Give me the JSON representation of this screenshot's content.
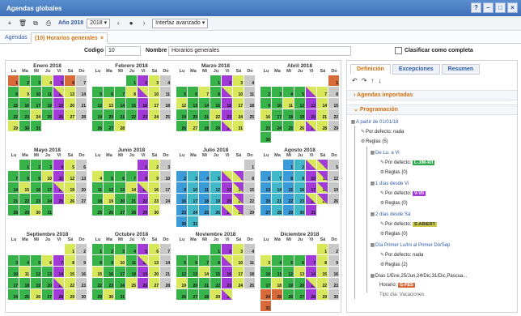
{
  "window": {
    "title": "Agendas globales"
  },
  "toolbar": {
    "year_label": "Año 2018",
    "year_value": "2018 ▾",
    "prev_icon": "‹",
    "now_icon": "●",
    "next_icon": "›",
    "filter_value": "Interfaz avanzado ▾"
  },
  "tabs": {
    "agendas": "Agendas",
    "active": "(10) Horarios generales",
    "close": "×"
  },
  "fields": {
    "codigo_label": "Codigo",
    "codigo_value": "10",
    "nombre_label": "Nombre",
    "nombre_value": "Horarios generales",
    "clasificar_label": "Clasificar como completa"
  },
  "weekday_headers": [
    "Lu",
    "Ma",
    "Mi",
    "Ju",
    "Vi",
    "Sá",
    "Do"
  ],
  "months": [
    {
      "title": "Enero 2018"
    },
    {
      "title": "Febrero 2018"
    },
    {
      "title": "Marzo 2018"
    },
    {
      "title": "Abril 2018"
    },
    {
      "title": "Mayo 2018"
    },
    {
      "title": "Junio 2018"
    },
    {
      "title": "Julio 2018"
    },
    {
      "title": "Agosto 2018"
    },
    {
      "title": "Septiembre 2018"
    },
    {
      "title": "Octubre 2018"
    },
    {
      "title": "Noviembre 2018"
    },
    {
      "title": "Diciembre 2018"
    }
  ],
  "right_panel": {
    "tabs": [
      "Definición",
      "Excepciones",
      "Resumen"
    ],
    "sections": {
      "imported": "Agendas importadas",
      "programming": "Programación"
    },
    "tree": {
      "root": "A partir de 01/01/18",
      "default": "Por defecto: nada",
      "rules": "Reglas (5)",
      "group1": "De Lu. a Vi",
      "g1_default": "Por defecto:",
      "g1_badge": "L-J/M-R/I",
      "g1_rules": "Reglas (0)",
      "group2": "1 días desde Vi",
      "g2_default": "Por defecto:",
      "g2_badge": "V-Vii",
      "g2_rules": "Reglas (0)",
      "group3": "2 días desde Sá",
      "g3_default": "Por defecto:",
      "g3_badge": "S-ABIERT",
      "g3_rules": "Reglas (0)",
      "group4": "Día Primer Lu/Ini al Primer Do/Sep",
      "g4_default": "Por defecto: nada",
      "g4_rules": "Reglas (2)",
      "group5": "Días 1/Ene,25/Jun,24/Dic,31/Dic,Pascua...",
      "g5_horario": "Horario:",
      "g5_badge": "G-FES",
      "g5_tipo": "Tipo día: Vacaciones"
    },
    "badge_colors": {
      "g1": "#2aa84a",
      "g2": "#a23ad8",
      "g3": "#c8c84a",
      "g5": "#d86a3a"
    }
  }
}
